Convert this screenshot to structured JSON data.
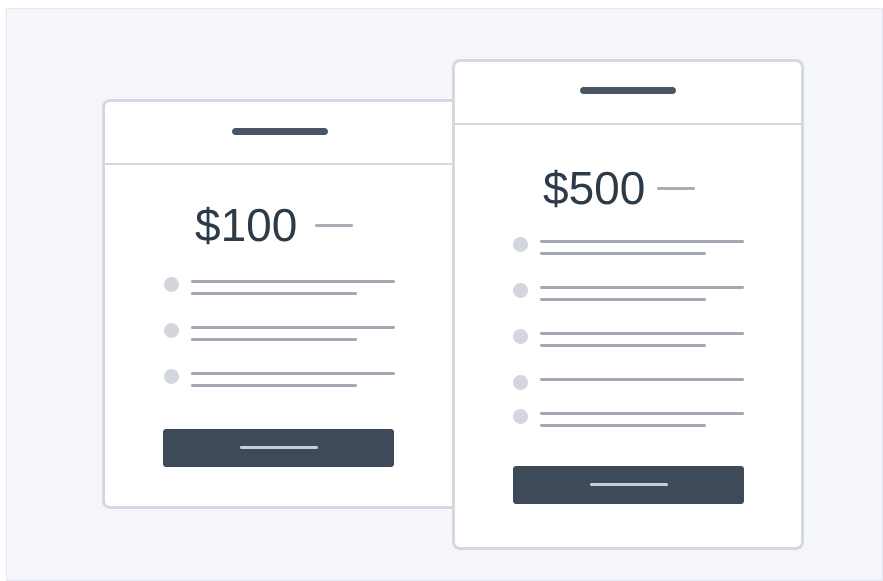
{
  "colors": {
    "background": "#f4f6f9",
    "card_border": "#d5d9df",
    "price_text": "#2d3a48",
    "button": "#3e4a57"
  },
  "plans": [
    {
      "price": "$100",
      "feature_count": 3
    },
    {
      "price": "$500",
      "feature_count": 5
    }
  ]
}
